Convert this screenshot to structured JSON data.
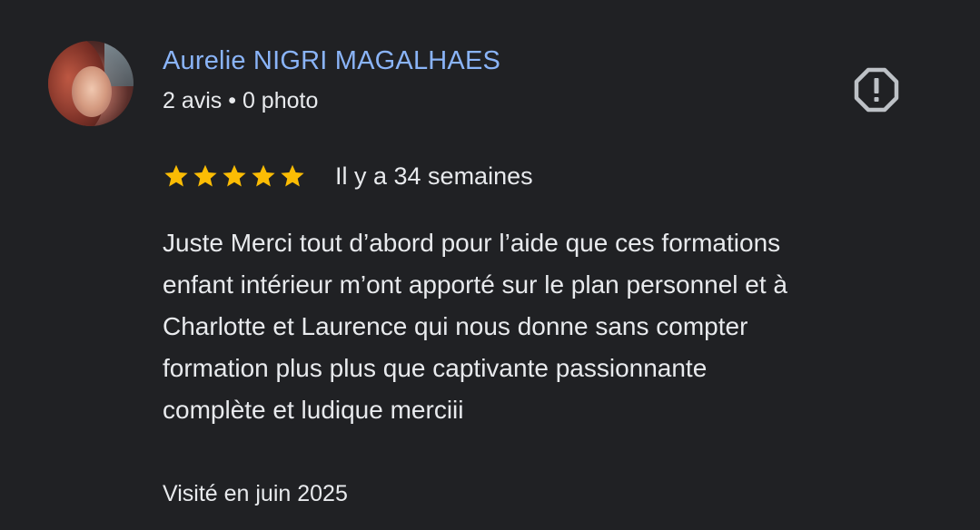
{
  "review": {
    "author": {
      "name": "Aurelie NIGRI MAGALHAES",
      "meta": "2 avis • 0 photo"
    },
    "rating": 5,
    "rating_max": 5,
    "date": "Il y a 34 semaines",
    "text_lines": [
      "Juste Merci tout d’abord pour l’aide que ces formations",
      "enfant intérieur m’ont apporté sur le plan personnel et à",
      "Charlotte et Laurence qui nous donne sans compter",
      "formation plus plus que captivante passionnante",
      "complète et ludique merciii"
    ],
    "visit": "Visité en juin 2025"
  },
  "icons": {
    "report": "report-octagon-icon",
    "star": "star-icon"
  },
  "colors": {
    "background": "#202124",
    "author_name": "#8ab4f8",
    "text": "#e8eaed",
    "star": "#fbbc04",
    "icon": "#bdc1c6"
  }
}
